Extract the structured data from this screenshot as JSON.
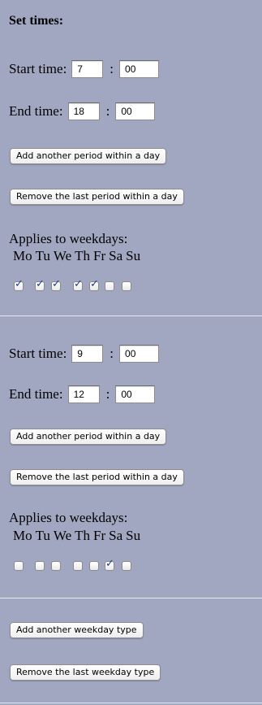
{
  "heading": "Set times:",
  "labels": {
    "start_time": "Start time:",
    "end_time": "End time:",
    "colon": ":",
    "applies": "Applies to weekdays:"
  },
  "buttons": {
    "add_period": "Add another period within a day",
    "remove_period": "Remove the last period within a day",
    "add_weekday_type": "Add another weekday type",
    "remove_weekday_type": "Remove the last weekday type"
  },
  "weekdays": [
    "Mo",
    "Tu",
    "We",
    "Th",
    "Fr",
    "Sa",
    "Su"
  ],
  "periods": [
    {
      "start_hour": "7",
      "start_min": "00",
      "end_hour": "18",
      "end_min": "00",
      "checked": [
        true,
        true,
        true,
        true,
        true,
        false,
        false
      ]
    },
    {
      "start_hour": "9",
      "start_min": "00",
      "end_hour": "12",
      "end_min": "00",
      "checked": [
        false,
        false,
        false,
        false,
        false,
        true,
        false
      ]
    }
  ],
  "colors": {
    "background": "#a2a7c1",
    "divider": "#e6e8f0",
    "check_mark": "#1b3f9a"
  }
}
